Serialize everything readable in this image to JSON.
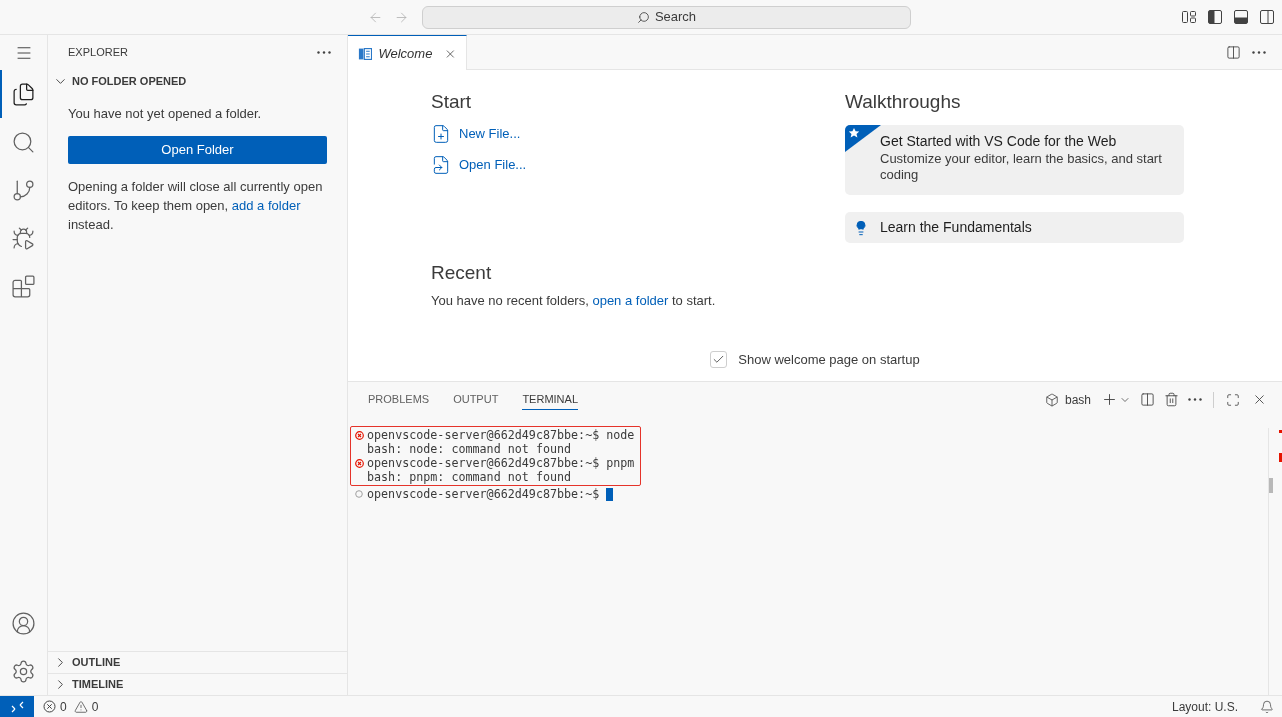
{
  "title_bar": {
    "search": "Search",
    "layout_toggles": [
      {
        "on": true
      },
      {
        "on": true
      },
      {
        "on": false
      }
    ]
  },
  "activity_bar": {
    "items": [
      {
        "selected": true
      },
      {
        "selected": false
      },
      {
        "selected": false
      },
      {
        "selected": false
      },
      {
        "selected": false
      }
    ]
  },
  "sidebar": {
    "title": "EXPLORER",
    "section": {
      "title": "NO FOLDER OPENED",
      "expanded": true,
      "message": "You have not yet opened a folder.",
      "button": "Open Folder",
      "note": {
        "text": "Opening a folder will close all currently open editors. To keep them open, ",
        "link": "add a folder",
        "tail": " instead."
      }
    },
    "collapsed_sections": [
      {
        "title": "OUTLINE",
        "expanded": false
      },
      {
        "title": "TIMELINE",
        "expanded": false
      }
    ]
  },
  "editor": {
    "tabs": [
      {
        "label": "Welcome",
        "selected": true
      }
    ],
    "welcome": {
      "start": {
        "title": "Start",
        "items": [
          {
            "kind": "new_file",
            "label": "New File..."
          },
          {
            "kind": "open_file",
            "label": "Open File..."
          }
        ]
      },
      "recent": {
        "title": "Recent",
        "text": "You have no recent folders, ",
        "link": "open a folder",
        "tail": " to start."
      },
      "walkthroughs": {
        "title": "Walkthroughs",
        "items": [
          {
            "kind": "featured",
            "title": "Get Started with VS Code for the Web",
            "description": "Customize your editor, learn the basics, and start coding"
          },
          {
            "kind": "tip",
            "title": "Learn the Fundamentals"
          }
        ]
      },
      "startup_checkbox": {
        "label": "Show welcome page on startup",
        "checked": true
      }
    }
  },
  "panel": {
    "tabs": [
      {
        "label": "PROBLEMS",
        "selected": false
      },
      {
        "label": "OUTPUT",
        "selected": false
      },
      {
        "label": "TERMINAL",
        "selected": true
      }
    ],
    "terminal_name": "bash",
    "lines": [
      {
        "kind": "command",
        "failed": true,
        "highlighted": true,
        "text": "openvscode-server@662d49c87bbe:~$ node"
      },
      {
        "kind": "output",
        "highlighted": true,
        "text": "bash: node: command not found"
      },
      {
        "kind": "command",
        "failed": true,
        "highlighted": true,
        "text": "openvscode-server@662d49c87bbe:~$ pnpm"
      },
      {
        "kind": "output",
        "highlighted": true,
        "text": "bash: pnpm: command not found"
      },
      {
        "kind": "command",
        "failed": false,
        "highlighted": false,
        "cursor": true,
        "text": "openvscode-server@662d49c87bbe:~$"
      }
    ]
  },
  "status_bar": {
    "errors": "0",
    "warnings": "0",
    "layout": "Layout: U.S."
  }
}
